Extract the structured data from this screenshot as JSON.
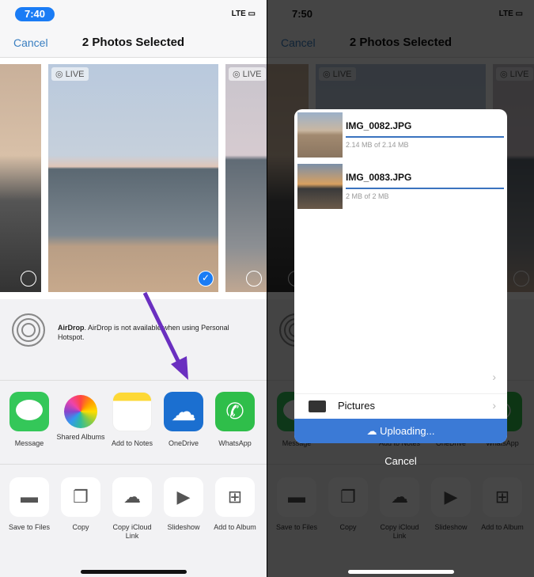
{
  "left": {
    "time": "7:40",
    "time_right": "7:50",
    "signal": "LTE"
  },
  "nav": {
    "cancel": "Cancel",
    "title": "2 Photos Selected"
  },
  "photos": {
    "live_label": "LIVE"
  },
  "airdrop": {
    "title": "AirDrop",
    "text": ". AirDrop is not available when using Personal Hotspot."
  },
  "apps": [
    {
      "label": "Message",
      "color": "#34c759"
    },
    {
      "label": "Shared Albums",
      "color": "#ffffff"
    },
    {
      "label": "Add to Notes",
      "color": "#ffffff"
    },
    {
      "label": "OneDrive",
      "color": "#1b6fd0"
    },
    {
      "label": "WhatsApp",
      "color": "#2fbe4a"
    }
  ],
  "actions": [
    {
      "label": "Save to Files",
      "icon": "folder-icon"
    },
    {
      "label": "Copy",
      "icon": "copy-icon"
    },
    {
      "label": "Copy iCloud Link",
      "icon": "cloud-link-icon"
    },
    {
      "label": "Slideshow",
      "icon": "play-icon"
    },
    {
      "label": "Add to Album",
      "icon": "add-album-icon"
    }
  ],
  "upload": {
    "files": [
      {
        "name": "IMG_0082.JPG",
        "size": "2.14 MB of 2.14 MB",
        "progress": 1.0
      },
      {
        "name": "IMG_0083.JPG",
        "size": "2 MB of 2 MB",
        "progress": 1.0
      }
    ],
    "folder": "Pictures",
    "status": "Uploading...",
    "cancel": "Cancel",
    "accent": "#3b7ad6"
  }
}
